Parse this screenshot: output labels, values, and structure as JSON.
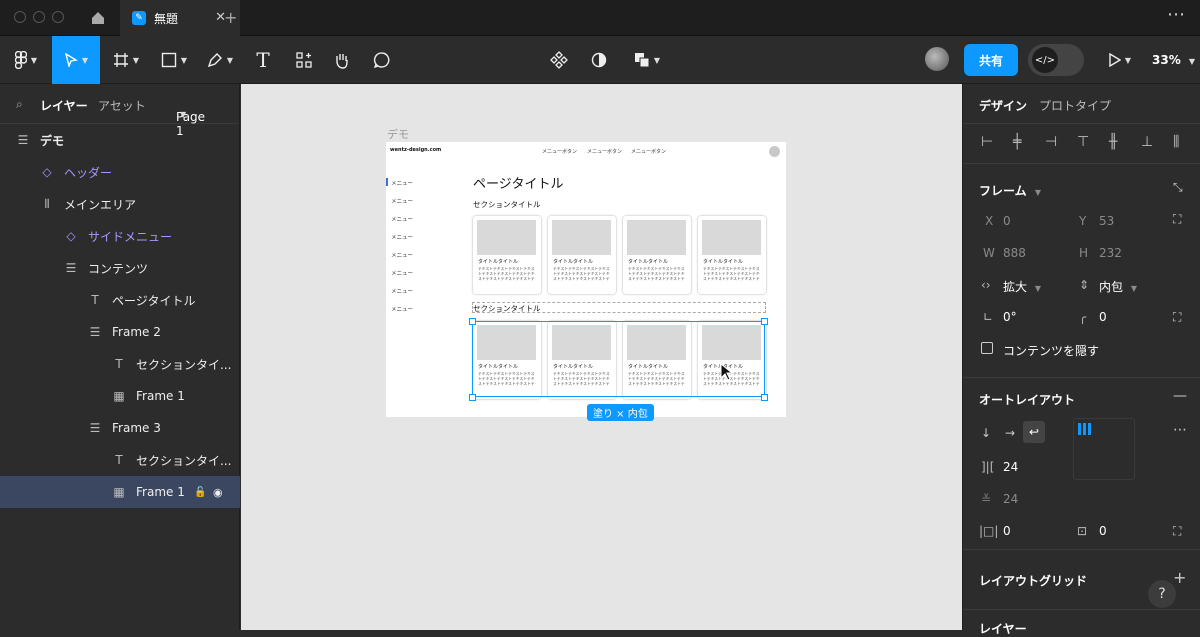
{
  "titlebar": {
    "tab_title": "無題",
    "close_label": "✕",
    "new_tab_label": "+",
    "more_label": "⋯"
  },
  "toolbar": {
    "share_label": "共有",
    "zoom_label": "33%",
    "text_tool_label": "T"
  },
  "left_panel": {
    "tabs": [
      "レイヤー",
      "アセット"
    ],
    "page_label": "Page 1",
    "layers": [
      {
        "label": "デモ",
        "icon": "frame-icon"
      },
      {
        "label": "ヘッダー",
        "icon": "component-icon"
      },
      {
        "label": "メインエリア",
        "icon": "vertical-autolayout-icon"
      },
      {
        "label": "サイドメニュー",
        "icon": "component-icon"
      },
      {
        "label": "コンテンツ",
        "icon": "autolayout-icon"
      },
      {
        "label": "ページタイトル",
        "icon": "text-icon"
      },
      {
        "label": "Frame 2",
        "icon": "autolayout-icon"
      },
      {
        "label": "セクションタイ...",
        "icon": "text-icon"
      },
      {
        "label": "Frame 1",
        "icon": "grid-icon"
      },
      {
        "label": "Frame 3",
        "icon": "autolayout-icon"
      },
      {
        "label": "セクションタイ...",
        "icon": "text-icon"
      },
      {
        "label": "Frame 1",
        "icon": "grid-icon"
      }
    ]
  },
  "canvas": {
    "frame_label": "デモ",
    "site_logo": "wentz-design.com",
    "nav_buttons": [
      "メニューボタン",
      "メニューボタン",
      "メニューボタン"
    ],
    "side_menu": [
      "メニュー",
      "メニュー",
      "メニュー",
      "メニュー",
      "メニュー",
      "メニュー",
      "メニュー",
      "メニュー"
    ],
    "page_title": "ページタイトル",
    "section_title_1": "セクションタイトル",
    "section_title_2": "セクションタイトル",
    "card_title": "タイトルタイトル",
    "card_body": "テキストテキストテキストテキストテキストテキストテキストテキストテキストテキストテキストテキストテキスト",
    "size_badge": "塗り × 内包"
  },
  "right_panel": {
    "tabs": [
      "デザイン",
      "プロトタイプ"
    ],
    "frame_section": "フレーム",
    "x_label": "X",
    "x_value": "0",
    "y_label": "Y",
    "y_value": "53",
    "w_label": "W",
    "w_value": "888",
    "h_label": "H",
    "h_value": "232",
    "width_mode": "拡大",
    "height_mode": "内包",
    "rotation": "0°",
    "radius": "0",
    "clip_label": "コンテンツを隠す",
    "autolayout_section": "オートレイアウト",
    "gap_h": "24",
    "gap_v": "24",
    "pad_h": "0",
    "pad_v": "0",
    "layout_grid_section": "レイアウトグリッド",
    "layer_section": "レイヤー"
  },
  "colors": {
    "accent": "#0d99ff",
    "component": "#a995ff",
    "panel": "#2c2c2c",
    "canvas": "#e5e5e5"
  }
}
